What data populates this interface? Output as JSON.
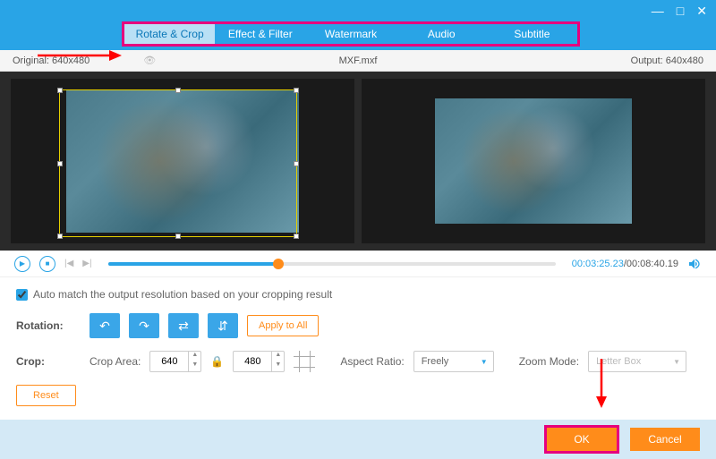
{
  "window": {
    "min": "—",
    "max": "□",
    "close": "✕"
  },
  "tabs": [
    "Rotate & Crop",
    "Effect & Filter",
    "Watermark",
    "Audio",
    "Subtitle"
  ],
  "info": {
    "original": "Original: 640x480",
    "filename": "MXF.mxf",
    "output": "Output: 640x480"
  },
  "time": {
    "current": "00:03:25.23",
    "total": "/00:08:40.19"
  },
  "automatch": "Auto match the output resolution based on your cropping result",
  "rotation_label": "Rotation:",
  "apply_all": "Apply to All",
  "crop_label": "Crop:",
  "crop_area": "Crop Area:",
  "crop_w": "640",
  "crop_h": "480",
  "aspect_label": "Aspect Ratio:",
  "aspect_val": "Freely",
  "zoom_label": "Zoom Mode:",
  "zoom_val": "Letter Box",
  "reset": "Reset",
  "ok": "OK",
  "cancel": "Cancel"
}
